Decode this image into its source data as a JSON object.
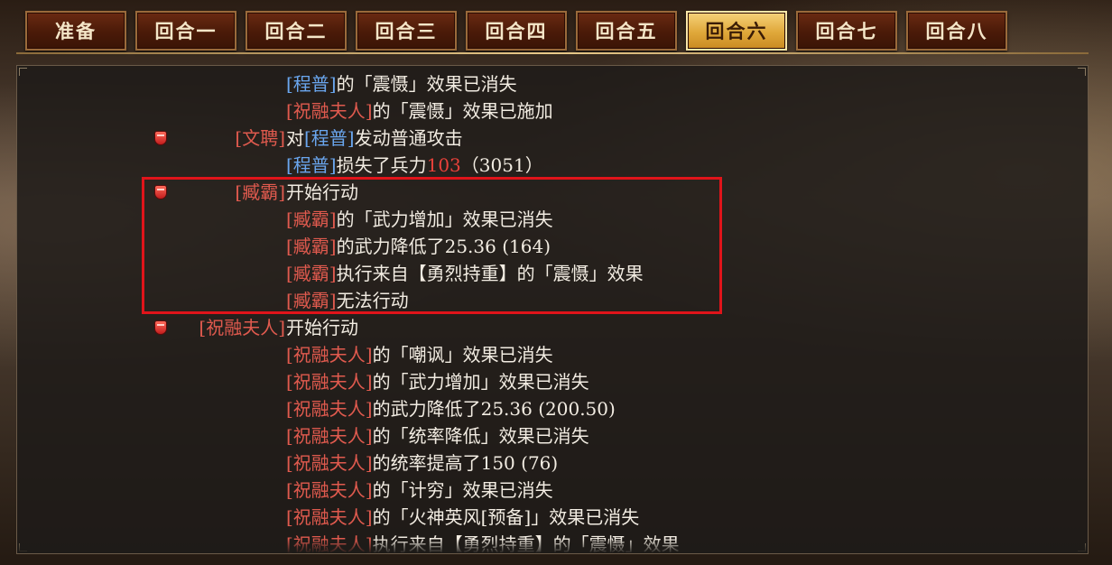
{
  "tabs": [
    {
      "label": "准备",
      "active": false
    },
    {
      "label": "回合一",
      "active": false
    },
    {
      "label": "回合二",
      "active": false
    },
    {
      "label": "回合三",
      "active": false
    },
    {
      "label": "回合四",
      "active": false
    },
    {
      "label": "回合五",
      "active": false
    },
    {
      "label": "回合六",
      "active": true
    },
    {
      "label": "回合七",
      "active": false
    },
    {
      "label": "回合八",
      "active": false
    }
  ],
  "log": [
    {
      "icon": false,
      "actor": "",
      "segs": [
        [
          "[程普]",
          "blue"
        ],
        [
          "的「震慑」效果已消失",
          ""
        ]
      ]
    },
    {
      "icon": false,
      "actor": "",
      "segs": [
        [
          "[祝融夫人]",
          "red"
        ],
        [
          "的「震慑」效果已施加",
          ""
        ]
      ]
    },
    {
      "icon": true,
      "actor": "[文聘]",
      "segs": [
        [
          "对",
          ""
        ],
        [
          "[程普]",
          "blue"
        ],
        [
          "发动普通攻击",
          ""
        ]
      ]
    },
    {
      "icon": false,
      "actor": "",
      "segs": [
        [
          "[程普]",
          "blue"
        ],
        [
          "损失了兵力",
          ""
        ],
        [
          "103",
          "num-red"
        ],
        [
          "（3051）",
          ""
        ]
      ]
    },
    {
      "icon": true,
      "actor": "[臧霸]",
      "segs": [
        [
          "开始行动",
          ""
        ]
      ]
    },
    {
      "icon": false,
      "actor": "",
      "segs": [
        [
          "[臧霸]",
          "red"
        ],
        [
          "的「武力增加」效果已消失",
          ""
        ]
      ]
    },
    {
      "icon": false,
      "actor": "",
      "segs": [
        [
          "[臧霸]",
          "red"
        ],
        [
          "的武力降低了25.36 (164)",
          ""
        ]
      ]
    },
    {
      "icon": false,
      "actor": "",
      "segs": [
        [
          "[臧霸]",
          "red"
        ],
        [
          "执行来自【勇烈持重】的「震慑」效果",
          ""
        ]
      ]
    },
    {
      "icon": false,
      "actor": "",
      "segs": [
        [
          "[臧霸]",
          "red"
        ],
        [
          "无法行动",
          ""
        ]
      ]
    },
    {
      "icon": true,
      "actor": "[祝融夫人]",
      "segs": [
        [
          "开始行动",
          ""
        ]
      ]
    },
    {
      "icon": false,
      "actor": "",
      "segs": [
        [
          "[祝融夫人]",
          "red"
        ],
        [
          "的「嘲讽」效果已消失",
          ""
        ]
      ]
    },
    {
      "icon": false,
      "actor": "",
      "segs": [
        [
          "[祝融夫人]",
          "red"
        ],
        [
          "的「武力增加」效果已消失",
          ""
        ]
      ]
    },
    {
      "icon": false,
      "actor": "",
      "segs": [
        [
          "[祝融夫人]",
          "red"
        ],
        [
          "的武力降低了25.36 (200.50)",
          ""
        ]
      ]
    },
    {
      "icon": false,
      "actor": "",
      "segs": [
        [
          "[祝融夫人]",
          "red"
        ],
        [
          "的「统率降低」效果已消失",
          ""
        ]
      ]
    },
    {
      "icon": false,
      "actor": "",
      "segs": [
        [
          "[祝融夫人]",
          "red"
        ],
        [
          "的统率提高了150 (76)",
          ""
        ]
      ]
    },
    {
      "icon": false,
      "actor": "",
      "segs": [
        [
          "[祝融夫人]",
          "red"
        ],
        [
          "的「计穷」效果已消失",
          ""
        ]
      ]
    },
    {
      "icon": false,
      "actor": "",
      "segs": [
        [
          "[祝融夫人]",
          "red"
        ],
        [
          "的「火神英风[预备]」效果已消失",
          ""
        ]
      ]
    },
    {
      "icon": false,
      "actor": "",
      "segs": [
        [
          "[祝融夫人]",
          "red"
        ],
        [
          "执行来自【勇烈持重】的「震慑」效果",
          ""
        ]
      ]
    }
  ]
}
